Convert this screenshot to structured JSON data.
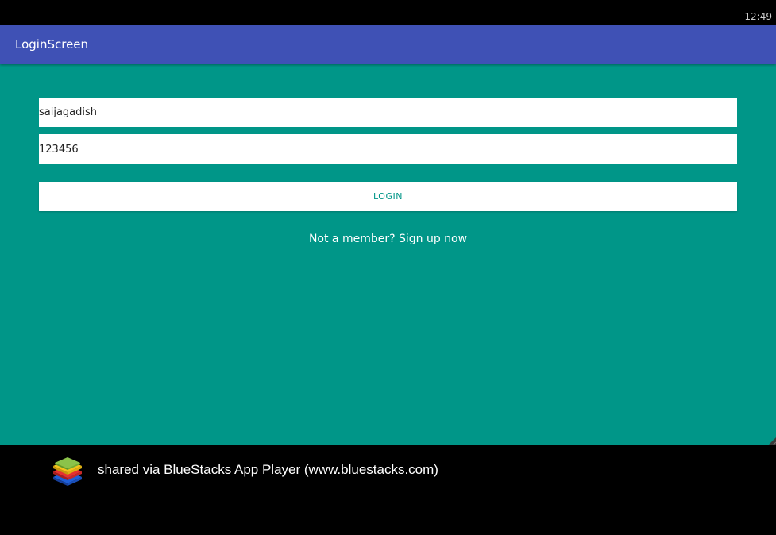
{
  "status_bar": {
    "time": "12:49"
  },
  "app_bar": {
    "title": "LoginScreen",
    "background_color": "#3f51b5"
  },
  "form": {
    "background_color": "#009688",
    "username": {
      "value": "saijagadish"
    },
    "password": {
      "value": "123456"
    },
    "login_button": {
      "label": "LOGIN",
      "text_color": "#009688"
    },
    "signup_link": {
      "label": "Not a member? Sign up now"
    }
  },
  "footer": {
    "logo_icon": "bluestacks-logo-icon",
    "caption": "shared via BlueStacks App Player (www.bluestacks.com)"
  }
}
